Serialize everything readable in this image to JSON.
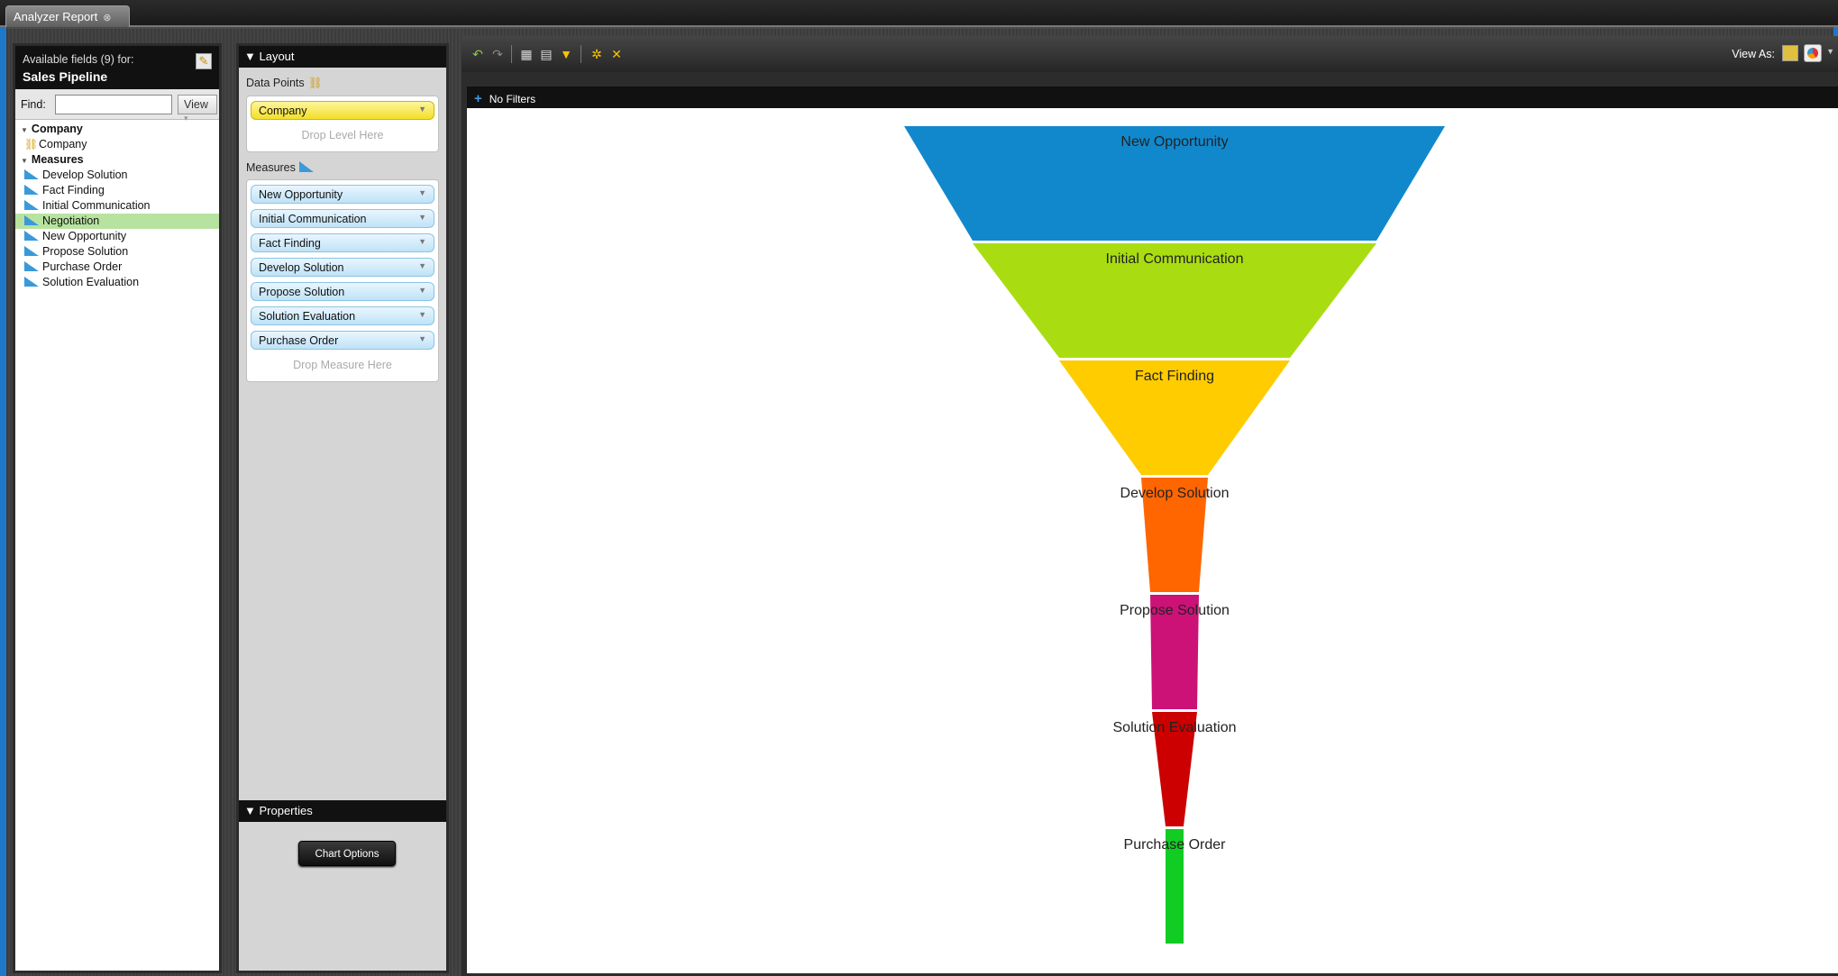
{
  "tab": {
    "title": "Analyzer Report"
  },
  "fields_panel": {
    "header": "Available fields (9) for:",
    "model": "Sales Pipeline",
    "find_label": "Find:",
    "view_label": "View",
    "groups": [
      {
        "label": "Company",
        "items": [
          {
            "label": "Company",
            "icon": "level-icon",
            "selected": false
          }
        ]
      },
      {
        "label": "Measures",
        "items": [
          {
            "label": "Develop Solution",
            "icon": "measure-icon",
            "selected": false
          },
          {
            "label": "Fact Finding",
            "icon": "measure-icon",
            "selected": false
          },
          {
            "label": "Initial Communication",
            "icon": "measure-icon",
            "selected": false
          },
          {
            "label": "Negotiation",
            "icon": "measure-icon",
            "selected": true
          },
          {
            "label": "New Opportunity",
            "icon": "measure-icon",
            "selected": false
          },
          {
            "label": "Propose Solution",
            "icon": "measure-icon",
            "selected": false
          },
          {
            "label": "Purchase Order",
            "icon": "measure-icon",
            "selected": false
          },
          {
            "label": "Solution Evaluation",
            "icon": "measure-icon",
            "selected": false
          }
        ]
      }
    ]
  },
  "layout_panel": {
    "title": "▼ Layout",
    "data_points_label": "Data Points",
    "data_points": [
      "Company"
    ],
    "drop_level_hint": "Drop Level Here",
    "measures_label": "Measures",
    "measures": [
      "New Opportunity",
      "Initial Communication",
      "Fact Finding",
      "Develop Solution",
      "Propose Solution",
      "Solution Evaluation",
      "Purchase Order"
    ],
    "drop_measure_hint": "Drop Measure Here",
    "properties_title": "▼ Properties",
    "chart_options_label": "Chart Options"
  },
  "report": {
    "view_as_label": "View As:",
    "filter_text": "No Filters"
  },
  "chart_data": {
    "type": "funnel",
    "stages": [
      {
        "label": "New Opportunity",
        "color": "#1188cc"
      },
      {
        "label": "Initial Communication",
        "color": "#aadd11"
      },
      {
        "label": "Fact Finding",
        "color": "#ffcc00"
      },
      {
        "label": "Develop Solution",
        "color": "#ff6600"
      },
      {
        "label": "Propose Solution",
        "color": "#cc1177"
      },
      {
        "label": "Solution Evaluation",
        "color": "#cc0000"
      },
      {
        "label": "Purchase Order",
        "color": "#11cc22"
      }
    ]
  }
}
